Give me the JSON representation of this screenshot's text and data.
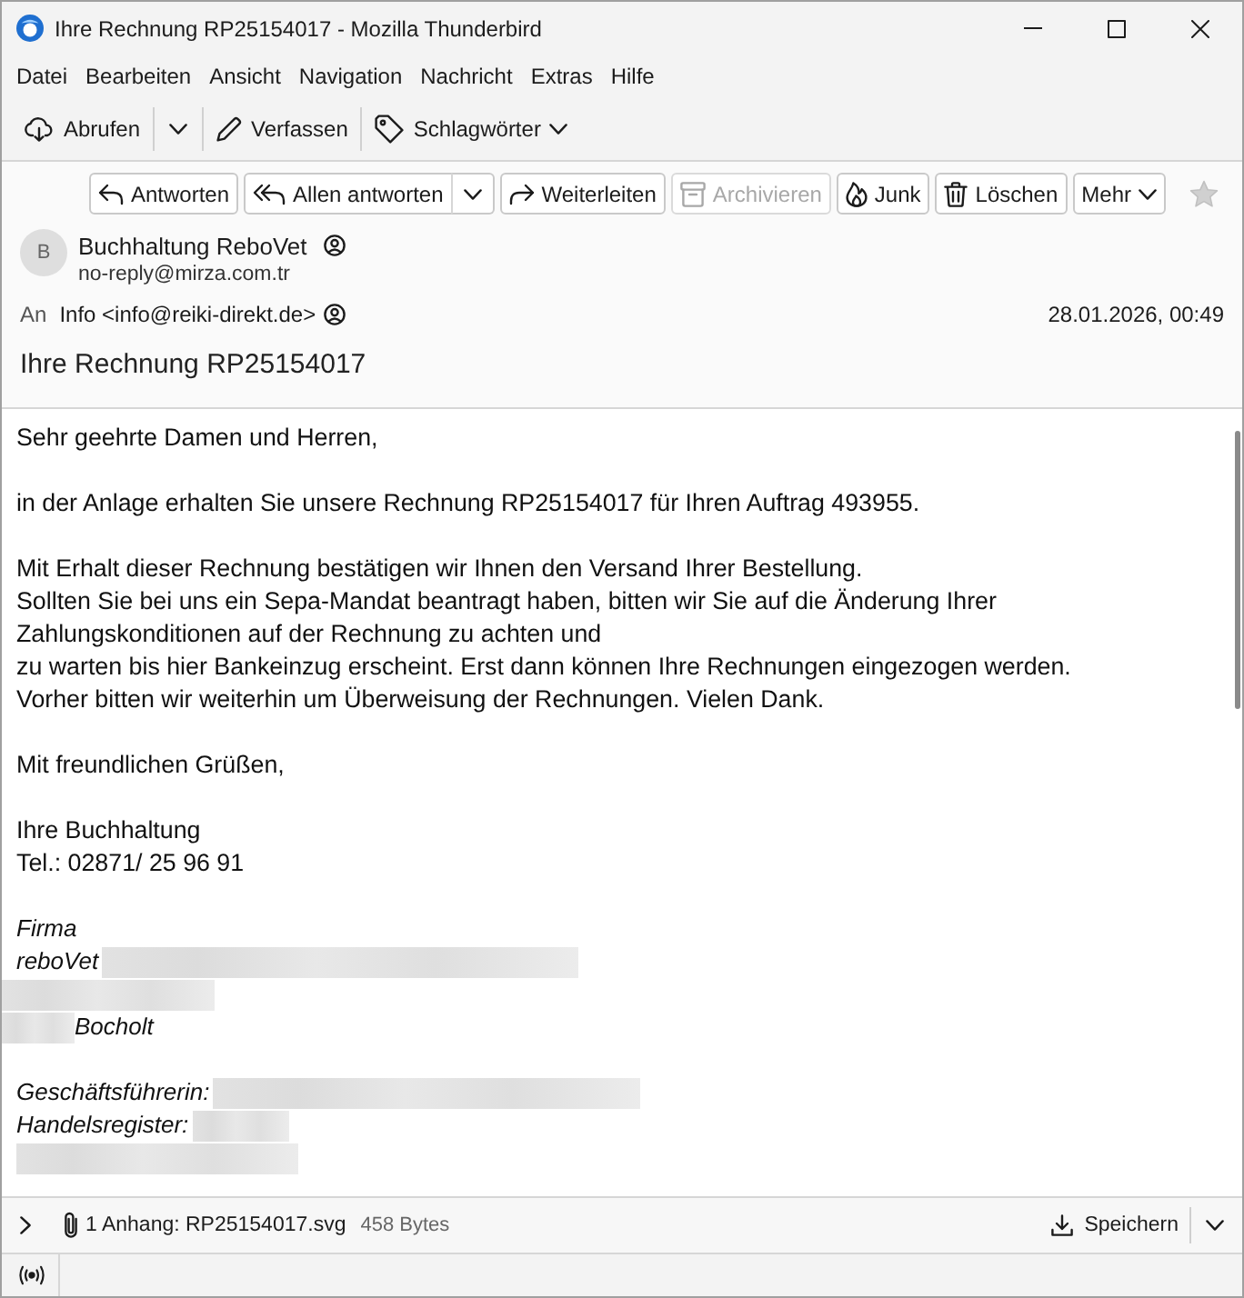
{
  "window": {
    "title": "Ihre Rechnung RP25154017 - Mozilla Thunderbird"
  },
  "menu_bar": [
    "Datei",
    "Bearbeiten",
    "Ansicht",
    "Navigation",
    "Nachricht",
    "Extras",
    "Hilfe"
  ],
  "toolbar": [
    {
      "label": "Abrufen",
      "kind": "split"
    },
    {
      "label": "Verfassen",
      "kind": "button"
    },
    {
      "label": "Schlagwörter",
      "kind": "menu"
    }
  ],
  "message_header": {
    "actions": [
      {
        "label": "Antworten",
        "kind": "button",
        "disabled": false
      },
      {
        "label": "Allen antworten",
        "kind": "split",
        "disabled": false
      },
      {
        "label": "Weiterleiten",
        "kind": "button",
        "disabled": false
      },
      {
        "label": "Archivieren",
        "kind": "button",
        "disabled": true
      },
      {
        "label": "Junk",
        "kind": "button",
        "disabled": false
      },
      {
        "label": "Löschen",
        "kind": "button",
        "disabled": false
      },
      {
        "label": "Mehr",
        "kind": "menu",
        "disabled": false
      }
    ],
    "starred": false,
    "sender": {
      "initial": "B",
      "name": "Buchhaltung ReboVet",
      "email": "no-reply@mirza.com.tr"
    },
    "recipient": {
      "label": "An",
      "value": "Info <info@reiki-direkt.de>"
    },
    "date": "28.01.2026, 00:49",
    "subject": "Ihre Rechnung RP25154017"
  },
  "body": {
    "paragraphs": [
      "Sehr geehrte Damen und Herren,",
      "in der Anlage erhalten Sie unsere Rechnung RP25154017 für Ihren Auftrag 493955.",
      "Mit Erhalt dieser Rechnung bestätigen wir Ihnen den Versand Ihrer Bestellung.\nSollten Sie bei uns ein Sepa-Mandat beantragt haben, bitten wir Sie auf die Änderung Ihrer\nZahlungskonditionen auf der Rechnung zu achten und\nzu warten bis hier Bankeinzug erscheint. Erst dann können Ihre Rechnungen eingezogen werden.\nVorher bitten wir weiterhin um Überweisung der Rechnungen. Vielen Dank.",
      "Mit freundlichen Grüßen,",
      "Ihre Buchhaltung\nTel.: 02871/ 25 96 91"
    ],
    "signature": [
      {
        "lines": [
          [
            {
              "kind": "text",
              "text": "Firma"
            }
          ],
          [
            {
              "kind": "text",
              "text": "reboVet"
            },
            {
              "kind": "redaction"
            }
          ],
          [
            {
              "kind": "redaction"
            }
          ],
          [
            {
              "kind": "redaction"
            },
            {
              "kind": "text",
              "text": "Bocholt"
            }
          ]
        ]
      },
      {
        "lines": [
          [
            {
              "kind": "text",
              "text": "Geschäftsführerin:"
            },
            {
              "kind": "redaction"
            }
          ],
          [
            {
              "kind": "text",
              "text": "Handelsregister:"
            },
            {
              "kind": "redaction"
            }
          ],
          [
            {
              "kind": "redaction"
            }
          ]
        ]
      }
    ]
  },
  "attachments": {
    "expanded": false,
    "summary": "1 Anhang: RP25154017.svg",
    "size": "458 Bytes",
    "save_label": "Speichern"
  }
}
